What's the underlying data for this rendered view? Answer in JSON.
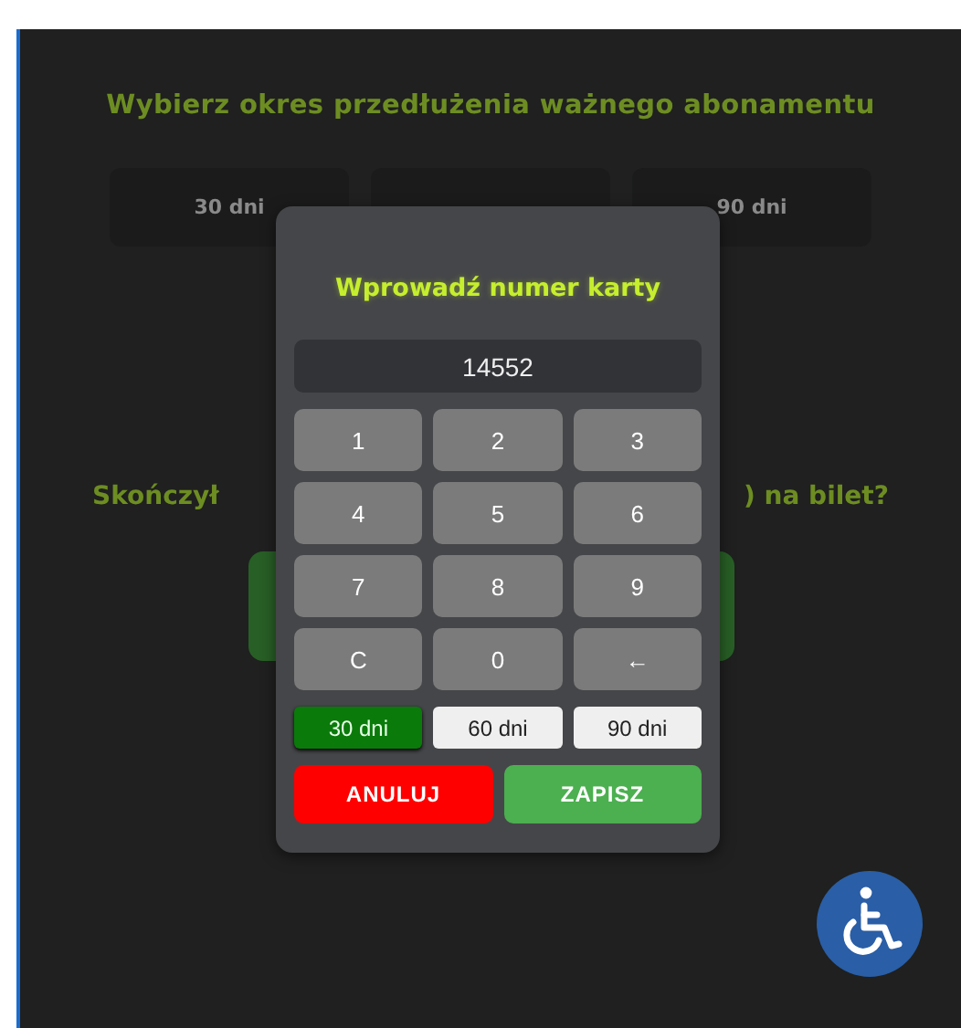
{
  "background": {
    "heading": "Wybierz okres przedłużenia ważnego abonamentu",
    "period_options": [
      {
        "label": "30 dni"
      },
      {
        "label": "90 dni"
      }
    ],
    "question_start": "Skończył",
    "question_end": ") na bilet?"
  },
  "card_dialog": {
    "title": "Wprowadź numer karty",
    "card_number": "14552",
    "keys": [
      {
        "label": "1"
      },
      {
        "label": "2"
      },
      {
        "label": "3"
      },
      {
        "label": "4"
      },
      {
        "label": "5"
      },
      {
        "label": "6"
      },
      {
        "label": "7"
      },
      {
        "label": "8"
      },
      {
        "label": "9"
      },
      {
        "label": "C"
      },
      {
        "label": "0"
      },
      {
        "label": "←"
      }
    ],
    "durations": [
      {
        "label": "30 dni",
        "selected": true
      },
      {
        "label": "60 dni",
        "selected": false
      },
      {
        "label": "90 dni",
        "selected": false
      }
    ],
    "buttons": [
      {
        "label": "ANULUJ",
        "kind": "cancel"
      },
      {
        "label": "ZAPISZ",
        "kind": "save"
      }
    ]
  }
}
